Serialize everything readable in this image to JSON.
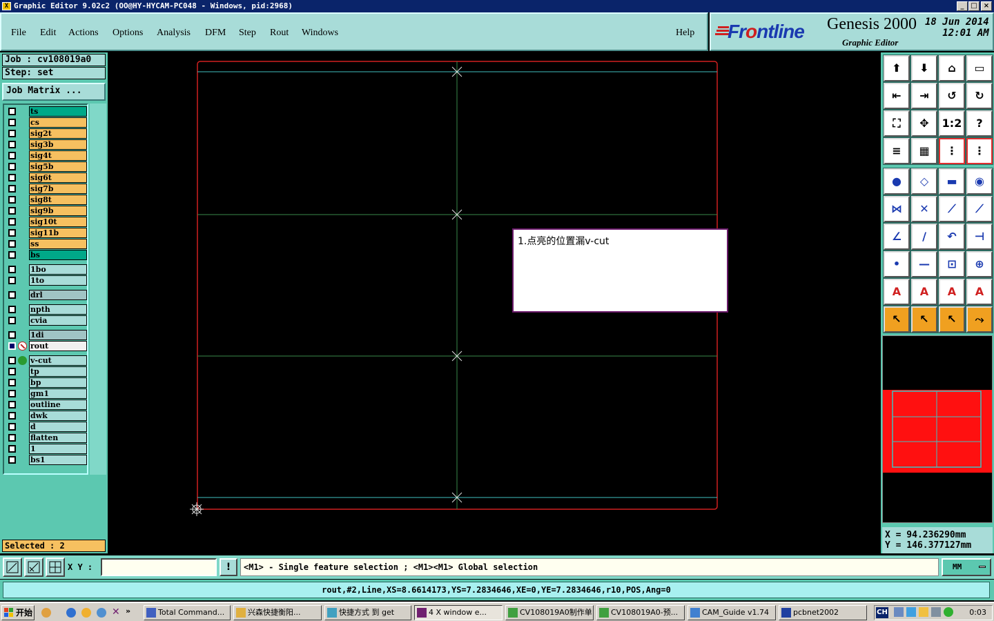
{
  "window": {
    "title": "Graphic Editor 9.02c2 (OO@HY-HYCAM-PC048 - Windows, pid:2968)"
  },
  "menu": {
    "items": [
      {
        "label": "File"
      },
      {
        "label": "Edit"
      },
      {
        "label": "Actions"
      },
      {
        "label": "Options"
      },
      {
        "label": "Analysis"
      },
      {
        "label": "DFM"
      },
      {
        "label": "Step"
      },
      {
        "label": "Rout"
      },
      {
        "label": "Windows"
      }
    ],
    "help": "Help"
  },
  "brand": {
    "logo_prefix": "Fr",
    "logo_o": "o",
    "logo_suffix": "ntline",
    "product": "Genesis 2000",
    "subtitle": "Graphic Editor",
    "date_line1": "18 Jun 2014",
    "date_line2": "12:01 AM"
  },
  "job": {
    "job_line": "Job : cv108019a0",
    "step_line": "Step: set",
    "matrix_button": "Job Matrix ..."
  },
  "layers": [
    {
      "name": "ts",
      "color": "#00a888"
    },
    {
      "name": "cs",
      "color": "#f6c060"
    },
    {
      "name": "sig2t",
      "color": "#f6c060"
    },
    {
      "name": "sig3b",
      "color": "#f6c060"
    },
    {
      "name": "sig4t",
      "color": "#f6c060"
    },
    {
      "name": "sig5b",
      "color": "#f6c060"
    },
    {
      "name": "sig6t",
      "color": "#f6c060"
    },
    {
      "name": "sig7b",
      "color": "#f6c060"
    },
    {
      "name": "sig8t",
      "color": "#f6c060"
    },
    {
      "name": "sig9b",
      "color": "#f6c060"
    },
    {
      "name": "sig10t",
      "color": "#f6c060"
    },
    {
      "name": "sig11b",
      "color": "#f6c060"
    },
    {
      "name": "ss",
      "color": "#f6c060"
    },
    {
      "name": "bs",
      "color": "#00a888"
    },
    {
      "name": "1bo",
      "color": "#a8dcd8"
    },
    {
      "name": "1to",
      "color": "#a8dcd8"
    },
    {
      "name": "drl",
      "color": "#a0c4c4"
    },
    {
      "name": "npth",
      "color": "#a8dcd8"
    },
    {
      "name": "cvia",
      "color": "#a8dcd8"
    },
    {
      "name": "1di",
      "color": "#a0c4c4"
    },
    {
      "name": "rout",
      "color": "#f0f0f0",
      "work": true
    },
    {
      "name": "v-cut",
      "color": "#a8dcd8",
      "displayed": true
    },
    {
      "name": "tp",
      "color": "#a8dcd8"
    },
    {
      "name": "bp",
      "color": "#a8dcd8"
    },
    {
      "name": "gm1",
      "color": "#a8dcd8"
    },
    {
      "name": "outline",
      "color": "#a8dcd8"
    },
    {
      "name": "dwk",
      "color": "#a8dcd8"
    },
    {
      "name": "d",
      "color": "#a8dcd8"
    },
    {
      "name": "flatten",
      "color": "#a8dcd8"
    },
    {
      "name": "1",
      "color": "#a8dcd8"
    },
    {
      "name": "bs1",
      "color": "#a8dcd8"
    }
  ],
  "selected": "Selected : 2",
  "annotation": "1.点亮的位置漏v-cut",
  "coords": {
    "x": "X  =  94.236290mm",
    "y": "Y  =  146.377127mm"
  },
  "command": {
    "xy_label": "X Y :",
    "xy_value": "",
    "excl": "!",
    "prompt": "<M1> - Single feature selection ; <M1><M1> Global selection",
    "units": "MM"
  },
  "status": "rout,#2,Line,XS=8.6614173,YS=7.2834646,XE=0,YE=7.2834646,r10,POS,Ang=0",
  "taskbar": {
    "start": "开始",
    "tasks": [
      {
        "label": "Total Command..."
      },
      {
        "label": "兴森快捷衡阳..."
      },
      {
        "label": "快捷方式 到 get"
      },
      {
        "label": "4 X window e..."
      },
      {
        "label": "CV108019A0制作单"
      },
      {
        "label": "CV108019A0-预..."
      },
      {
        "label": "CAM_Guide v1.74"
      },
      {
        "label": "pcbnet2002"
      }
    ],
    "lang": "CH",
    "clock": "0:03"
  },
  "colors": {
    "accent": "#5cc8b0",
    "panel": "#a8dcd8",
    "outline_red": "#d02020",
    "vcut_cyan": "#40c0c0",
    "route_green": "#3a8a4a"
  }
}
